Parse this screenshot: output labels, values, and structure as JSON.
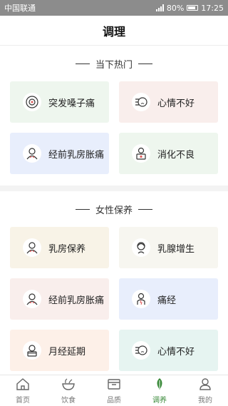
{
  "status": {
    "carrier": "中国联通",
    "battery": "80%",
    "time": "17:25"
  },
  "header": {
    "title": "调理"
  },
  "section1": {
    "title": "当下热门",
    "items": [
      {
        "label": "突发嗓子痛",
        "icon": "throat-icon",
        "color": "#eef6ee"
      },
      {
        "label": "心情不好",
        "icon": "mood-icon",
        "color": "#f9eeec"
      },
      {
        "label": "经前乳房胀痛",
        "icon": "woman-icon",
        "color": "#e8eefc"
      },
      {
        "label": "消化不良",
        "icon": "stomach-icon",
        "color": "#eef6ee"
      }
    ]
  },
  "section2": {
    "title": "女性保养",
    "items": [
      {
        "label": "乳房保养",
        "icon": "woman-icon",
        "color": "#f8f3e7"
      },
      {
        "label": "乳腺增生",
        "icon": "woman-face-icon",
        "color": "#f7f6f0"
      },
      {
        "label": "经前乳房胀痛",
        "icon": "woman-icon",
        "color": "#f9eeec"
      },
      {
        "label": "痛经",
        "icon": "pain-icon",
        "color": "#e8eefc"
      },
      {
        "label": "月经延期",
        "icon": "calendar-face-icon",
        "color": "#fdf0e8"
      },
      {
        "label": "心情不好",
        "icon": "mood-icon",
        "color": "#e6f4f1"
      }
    ]
  },
  "tabs": [
    {
      "label": "首页",
      "icon": "home-icon",
      "active": false
    },
    {
      "label": "饮食",
      "icon": "bowl-icon",
      "active": false
    },
    {
      "label": "品质",
      "icon": "box-icon",
      "active": false
    },
    {
      "label": "调养",
      "icon": "leaf-icon",
      "active": true
    },
    {
      "label": "我的",
      "icon": "user-icon",
      "active": false
    }
  ]
}
